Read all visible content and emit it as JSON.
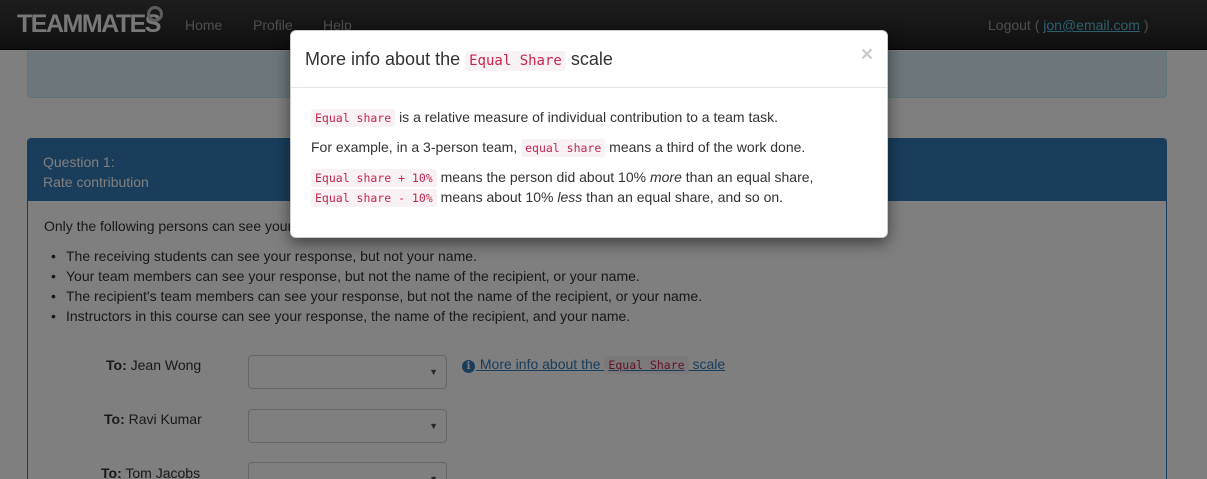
{
  "navbar": {
    "brand": "TEAMMATES",
    "links": [
      "Home",
      "Profile",
      "Help"
    ],
    "logout_label": "Logout (",
    "user_email": "jon@email.com",
    "logout_close": ")"
  },
  "question": {
    "number": "Question 1:",
    "title": "Rate contribution"
  },
  "visibility": {
    "intro": "Only the following persons can see your response:",
    "items": [
      "The receiving students can see your response, but not your name.",
      "Your team members can see your response, but not the name of the recipient, or your name.",
      "The recipient's team members can see your response, but not the name of the recipient, or your name.",
      "Instructors in this course can see your response, the name of the recipient, and your name."
    ]
  },
  "recipients": {
    "to_prefix": "To:",
    "names": [
      "Jean Wong",
      "Ravi Kumar",
      "Tom Jacobs"
    ]
  },
  "more_info_link": {
    "before": "More info about the",
    "code": "Equal Share",
    "after": "scale"
  },
  "modal": {
    "title_before": "More info about the",
    "title_code": "Equal Share",
    "title_after": "scale",
    "close": "×",
    "p1_code": "Equal share",
    "p1_text": "is a relative measure of individual contribution to a team task.",
    "p2_before": "For example, in a 3-person team,",
    "p2_code": "equal share",
    "p2_after": "means a third of the work done.",
    "p3_code": "Equal share + 10%",
    "p3_before": "means the person did about 10%",
    "p3_em": "more",
    "p3_after": "than an equal share,",
    "p4_code": "Equal share - 10%",
    "p4_before": "means about 10%",
    "p4_em": "less",
    "p4_after": "than an equal share, and so on."
  },
  "colors": {
    "primary": "#337ab7",
    "code_text": "#c7254e",
    "code_bg": "#f9f2f4"
  }
}
